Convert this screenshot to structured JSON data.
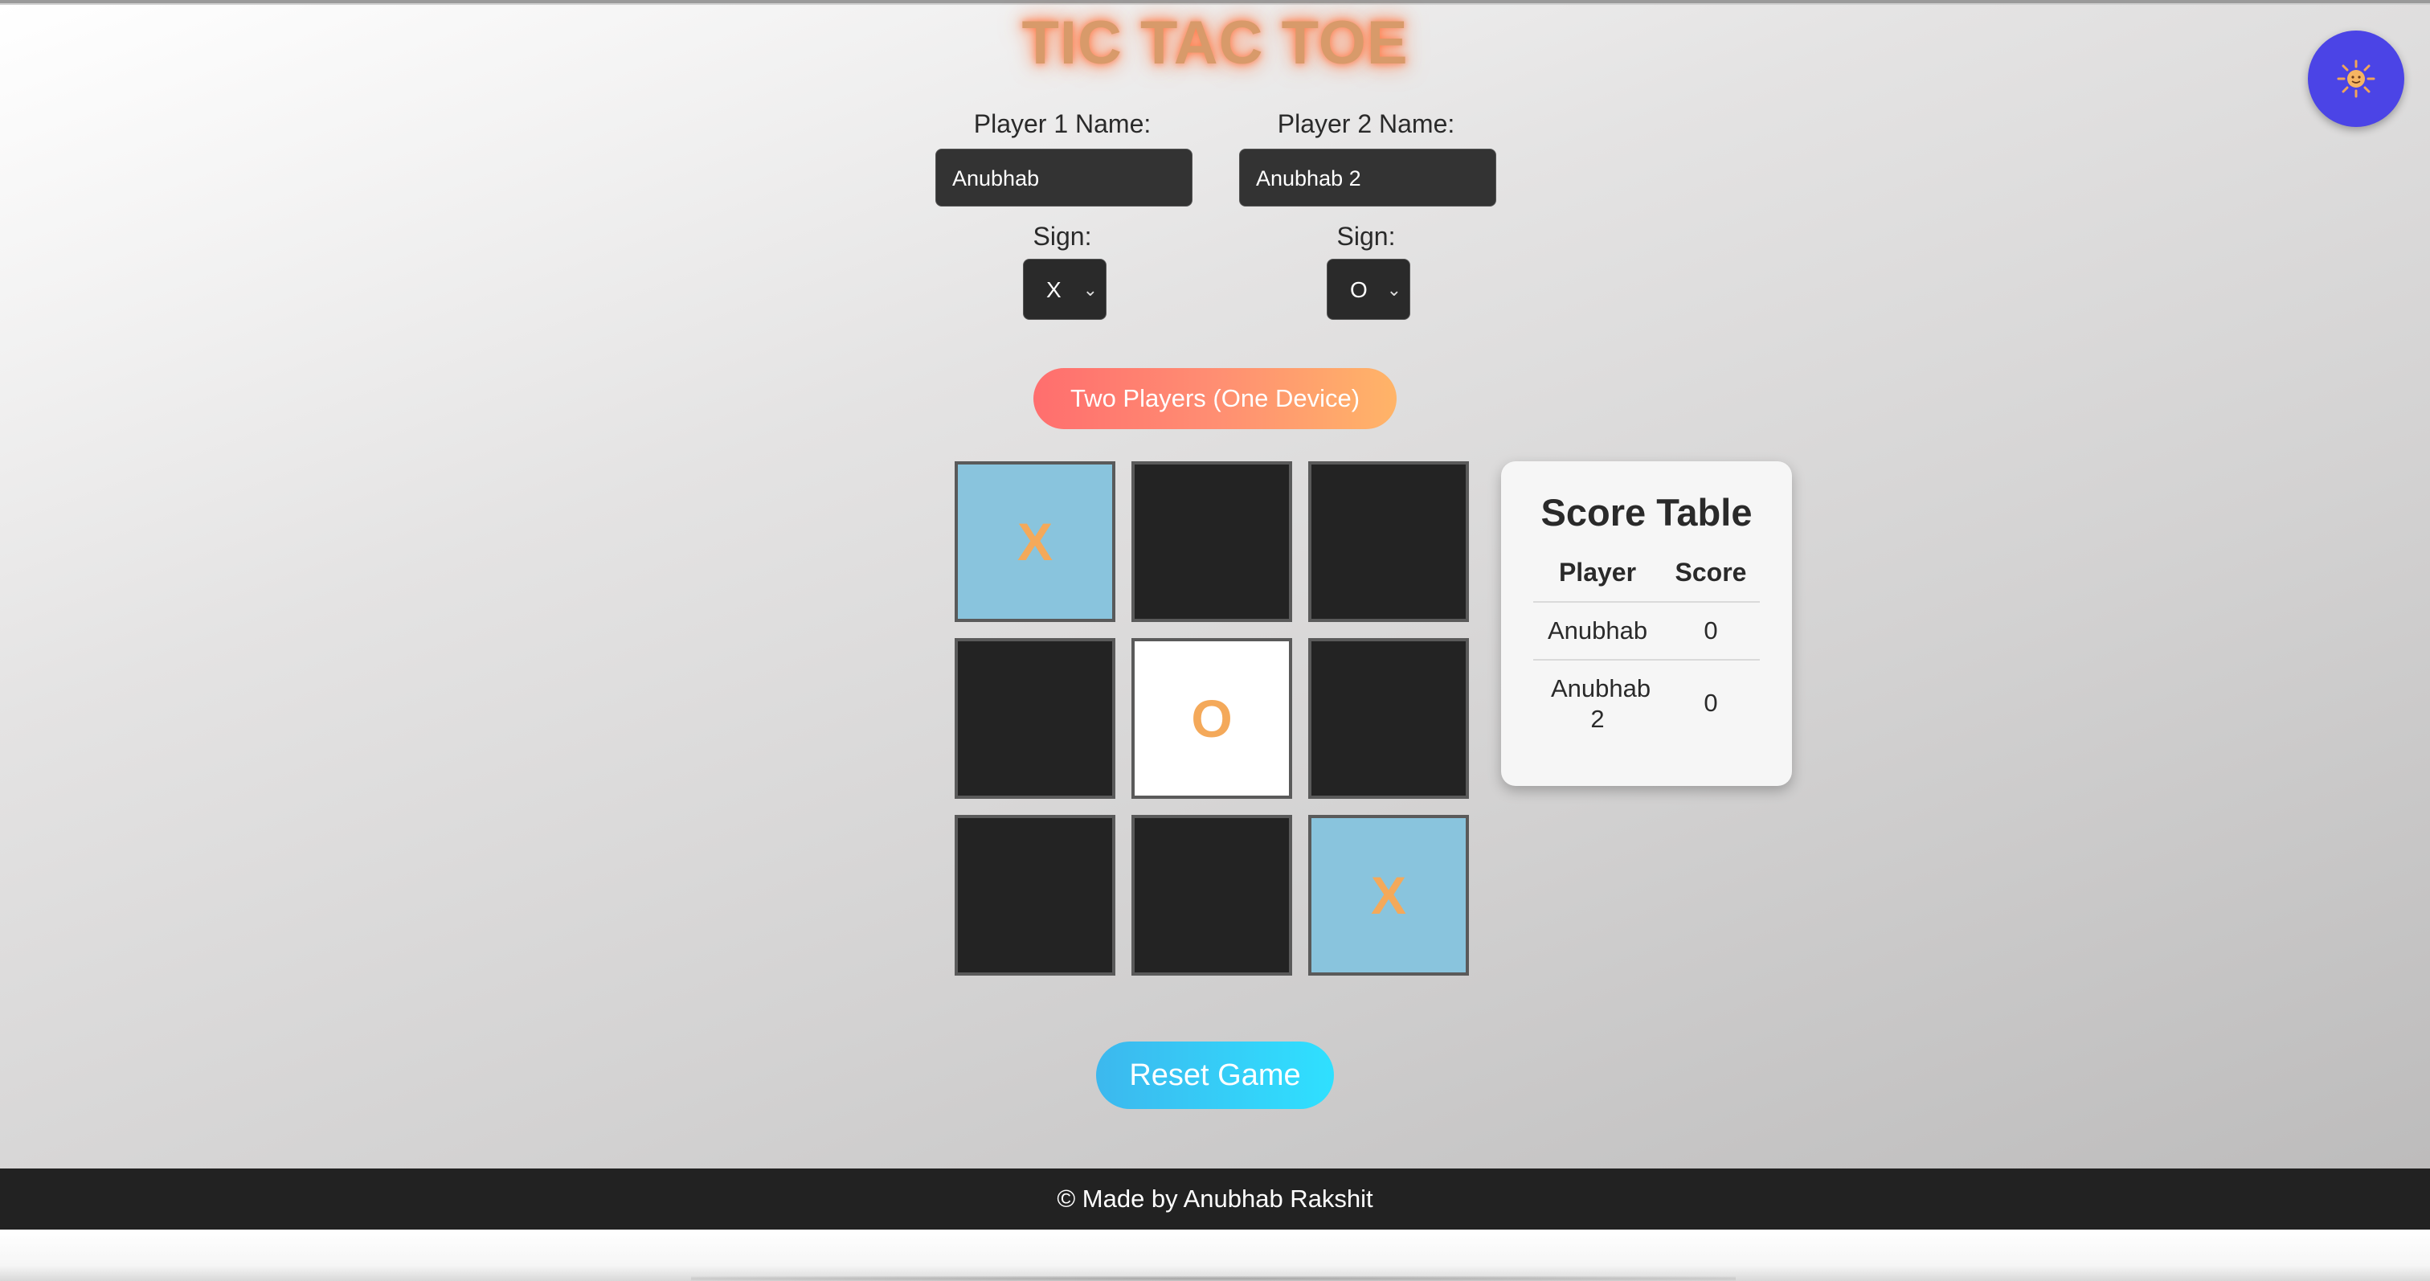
{
  "header": {
    "title": "TIC TAC TOE"
  },
  "players": {
    "p1": {
      "label": "Player 1 Name:",
      "name": "Anubhab",
      "sign_label": "Sign:",
      "sign": "X"
    },
    "p2": {
      "label": "Player 2 Name:",
      "name": "Anubhab 2",
      "sign_label": "Sign:",
      "sign": "O"
    }
  },
  "mode_button": "Two Players (One Device)",
  "board": [
    [
      "X",
      "",
      ""
    ],
    [
      "",
      "O",
      ""
    ],
    [
      "",
      "",
      "X"
    ]
  ],
  "score": {
    "title": "Score Table",
    "headers": [
      "Player",
      "Score"
    ],
    "rows": [
      {
        "player": "Anubhab",
        "score": "0"
      },
      {
        "player": "Anubhab 2",
        "score": "0"
      }
    ]
  },
  "reset_button": "Reset Game",
  "footer": "© Made by Anubhab Rakshit",
  "theme_toggle_icon": "sun-icon",
  "colors": {
    "x_cell": "#89c4dd",
    "o_cell": "#ffffff",
    "empty_cell": "#232323",
    "mark": "#f4a95a",
    "theme_button": "#4b44e6"
  }
}
